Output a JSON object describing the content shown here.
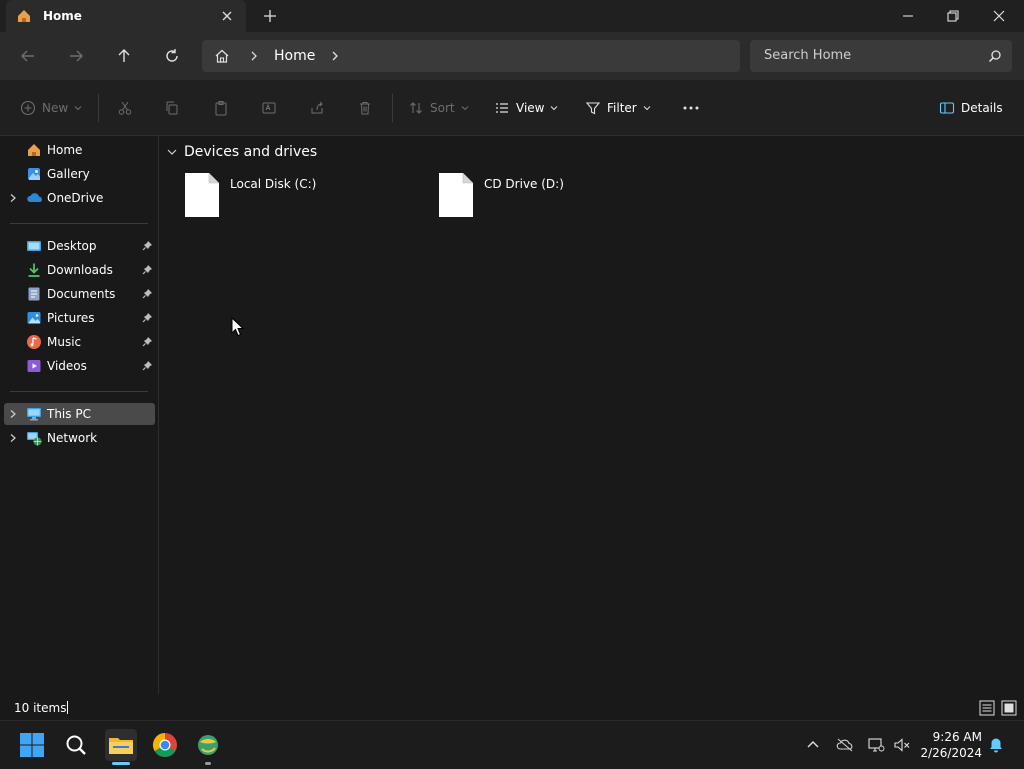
{
  "window": {
    "tab_title": "Home"
  },
  "navigation": {
    "breadcrumb": [
      "Home"
    ],
    "search_placeholder": "Search Home"
  },
  "command_bar": {
    "new_label": "New",
    "sort_label": "Sort",
    "view_label": "View",
    "filter_label": "Filter",
    "details_label": "Details"
  },
  "sidebar": {
    "quick": [
      {
        "label": "Home",
        "icon": "home-icon"
      },
      {
        "label": "Gallery",
        "icon": "gallery-icon"
      },
      {
        "label": "OneDrive",
        "icon": "onedrive-icon",
        "expandable": true
      }
    ],
    "pinned": [
      {
        "label": "Desktop",
        "icon": "desktop-icon"
      },
      {
        "label": "Downloads",
        "icon": "downloads-icon"
      },
      {
        "label": "Documents",
        "icon": "documents-icon"
      },
      {
        "label": "Pictures",
        "icon": "pictures-icon"
      },
      {
        "label": "Music",
        "icon": "music-icon"
      },
      {
        "label": "Videos",
        "icon": "videos-icon"
      }
    ],
    "locations": [
      {
        "label": "This PC",
        "icon": "this-pc-icon",
        "selected": true
      },
      {
        "label": "Network",
        "icon": "network-icon"
      }
    ]
  },
  "content": {
    "group_title": "Devices and drives",
    "drives": [
      {
        "label": "Local Disk (C:)"
      },
      {
        "label": "CD Drive (D:)"
      }
    ]
  },
  "status": {
    "item_count": "10 items"
  },
  "taskbar": {
    "time": "9:26 AM",
    "date": "2/26/2024"
  },
  "colors": {
    "accent": "#60cdff",
    "selected_bg": "#4a4a4a",
    "window_bg": "#191919"
  }
}
